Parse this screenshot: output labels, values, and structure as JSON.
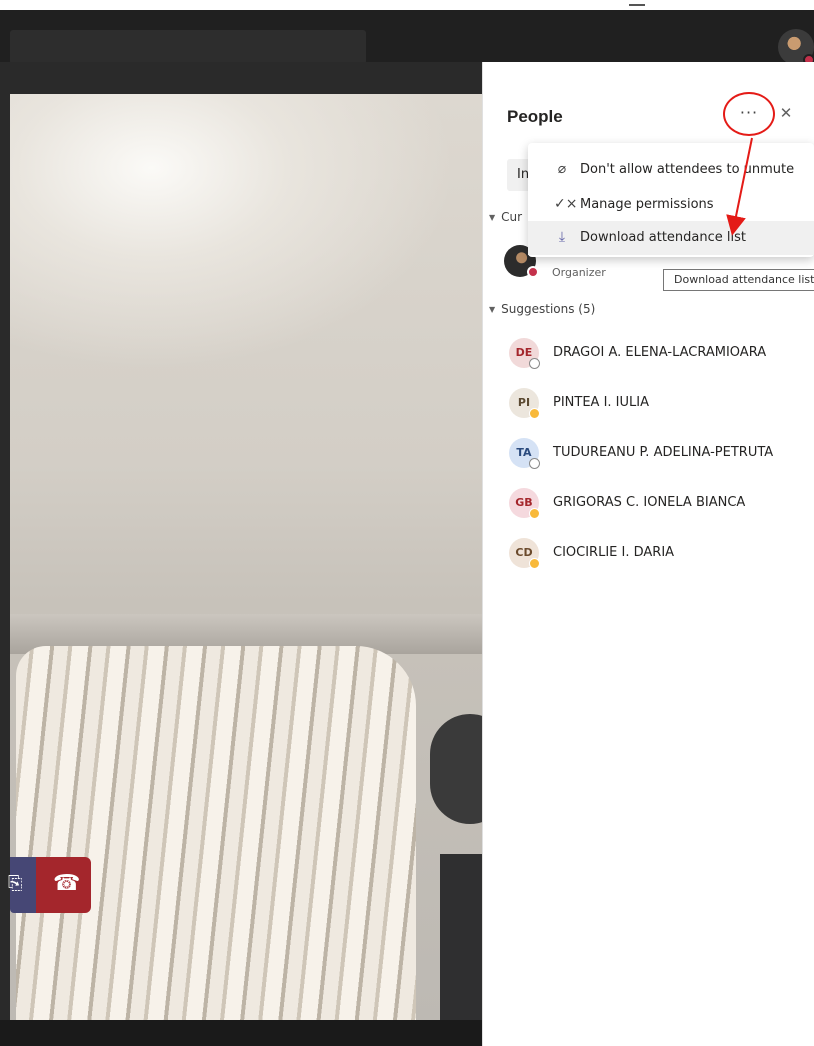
{
  "topbar": {
    "search_placeholder": ""
  },
  "controls": {
    "share_icon": "share-icon",
    "hangup_icon": "hang-up-icon"
  },
  "panel": {
    "title": "People",
    "more_glyph": "···",
    "close_glyph": "✕",
    "invite_label": "In",
    "current_group": "Cur",
    "organizer_role": "Organizer",
    "suggestions_group": "Suggestions (5)"
  },
  "menu": {
    "items": [
      {
        "icon": "mic-off-icon",
        "label": "Don't allow attendees to unmute"
      },
      {
        "icon": "check-x-icon",
        "label": "Manage permissions"
      },
      {
        "icon": "download-icon",
        "label": "Download attendance list"
      }
    ],
    "tooltip": "Download attendance list"
  },
  "suggestions": [
    {
      "initials": "DE",
      "name": "DRAGOI A. ELENA-LACRAMIOARA",
      "avatar_bg": "#f1d9d9",
      "avatar_fg": "#a4262c",
      "status": "offline"
    },
    {
      "initials": "PI",
      "name": "PINTEA I. IULIA",
      "avatar_bg": "#ece6dd",
      "avatar_fg": "#5c4a32",
      "status": "away"
    },
    {
      "initials": "TA",
      "name": "TUDUREANU P. ADELINA-PETRUTA",
      "avatar_bg": "#d5e2f5",
      "avatar_fg": "#2b4b7e",
      "status": "offline"
    },
    {
      "initials": "GB",
      "name": "GRIGORAS C. IONELA BIANCA",
      "avatar_bg": "#f5d9de",
      "avatar_fg": "#a4262c",
      "status": "away"
    },
    {
      "initials": "CD",
      "name": "CIOCIRLIE I. DARIA",
      "avatar_bg": "#efe3d8",
      "avatar_fg": "#6b4a2c",
      "status": "away"
    }
  ],
  "colors": {
    "accent": "#6264a7",
    "hangup": "#a4262c",
    "annotation_red": "#e41b17"
  }
}
